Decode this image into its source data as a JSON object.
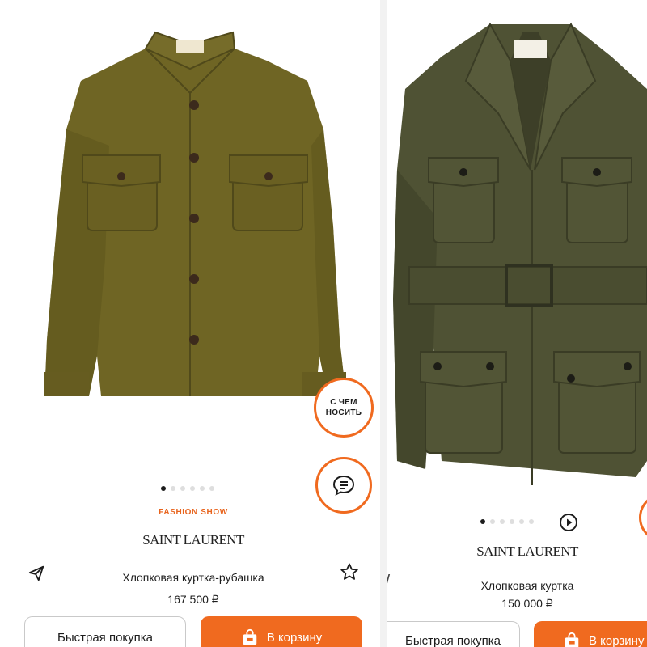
{
  "left_card": {
    "what_to_wear_label": "С ЧЕМ\nНОСИТЬ",
    "badge": "FASHION SHOW",
    "brand": "SAINT LAURENT",
    "title": "Хлопковая куртка-рубашка",
    "price": "167 500 ₽",
    "quick_buy_label": "Быстрая покупка",
    "add_to_cart_label": "В корзину",
    "gallery_dots": 6,
    "active_dot": 0,
    "icons": [
      "share-icon",
      "favorite-star-icon",
      "chat-icon",
      "cart-bag-icon"
    ]
  },
  "right_card": {
    "brand": "SAINT LAURENT",
    "title": "Хлопковая куртка",
    "price": "150 000 ₽",
    "quick_buy_label": "Быстрая покупка",
    "add_to_cart_label": "В корзину",
    "gallery_dots": 6,
    "active_dot": 0,
    "icons": [
      "play-icon",
      "cart-bag-icon"
    ]
  },
  "colors": {
    "accent": "#f06a1f",
    "shirt_jacket": "#6f6524",
    "safari_jacket": "#4f5234",
    "dot_active": "#1c1c1c",
    "dot_inactive": "#dedede"
  }
}
